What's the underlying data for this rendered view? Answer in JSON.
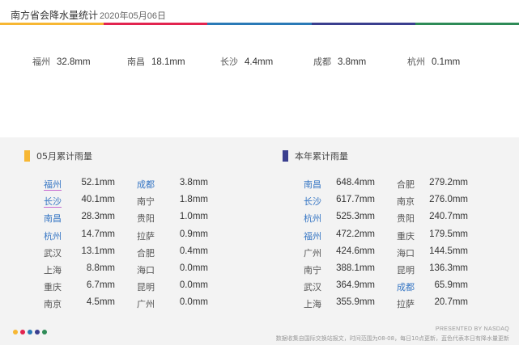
{
  "header": {
    "title": "南方省会降水量统计",
    "date": "2020年05月06日"
  },
  "colors": {
    "bar": [
      "#f7b733",
      "#e2244f",
      "#2a7ab7",
      "#3a3f8f",
      "#2e8b57"
    ],
    "highlight_city": "#3676c4",
    "underline": "#c76ad1",
    "section_may": "#f7b733",
    "section_year": "#3a3f8f",
    "dots": [
      "#f7b733",
      "#e2244f",
      "#2a7ab7",
      "#3a3f8f",
      "#2e8b57"
    ]
  },
  "today": [
    {
      "city": "福州",
      "value": "32.8mm"
    },
    {
      "city": "南昌",
      "value": "18.1mm"
    },
    {
      "city": "长沙",
      "value": "4.4mm"
    },
    {
      "city": "成都",
      "value": "3.8mm"
    },
    {
      "city": "杭州",
      "value": "0.1mm"
    }
  ],
  "may": {
    "title": "05月累计雨量",
    "col1": [
      {
        "city": "福州",
        "value": "52.1mm"
      },
      {
        "city": "长沙",
        "value": "40.1mm"
      },
      {
        "city": "南昌",
        "value": "28.3mm"
      },
      {
        "city": "杭州",
        "value": "14.7mm"
      },
      {
        "city": "武汉",
        "value": "13.1mm"
      },
      {
        "city": "上海",
        "value": "8.8mm"
      },
      {
        "city": "重庆",
        "value": "6.7mm"
      },
      {
        "city": "南京",
        "value": "4.5mm"
      }
    ],
    "col2": [
      {
        "city": "成都",
        "value": "3.8mm"
      },
      {
        "city": "南宁",
        "value": "1.8mm"
      },
      {
        "city": "贵阳",
        "value": "1.0mm"
      },
      {
        "city": "拉萨",
        "value": "0.9mm"
      },
      {
        "city": "合肥",
        "value": "0.4mm"
      },
      {
        "city": "海口",
        "value": "0.0mm"
      },
      {
        "city": "昆明",
        "value": "0.0mm"
      },
      {
        "city": "广州",
        "value": "0.0mm"
      }
    ]
  },
  "year": {
    "title": "本年累计雨量",
    "col1": [
      {
        "city": "南昌",
        "value": "648.4mm"
      },
      {
        "city": "长沙",
        "value": "617.7mm"
      },
      {
        "city": "杭州",
        "value": "525.3mm"
      },
      {
        "city": "福州",
        "value": "472.2mm"
      },
      {
        "city": "广州",
        "value": "424.6mm"
      },
      {
        "city": "南宁",
        "value": "388.1mm"
      },
      {
        "city": "武汉",
        "value": "364.9mm"
      },
      {
        "city": "上海",
        "value": "355.9mm"
      }
    ],
    "col2": [
      {
        "city": "合肥",
        "value": "279.2mm"
      },
      {
        "city": "南京",
        "value": "276.0mm"
      },
      {
        "city": "贵阳",
        "value": "240.7mm"
      },
      {
        "city": "重庆",
        "value": "179.5mm"
      },
      {
        "city": "海口",
        "value": "144.5mm"
      },
      {
        "city": "昆明",
        "value": "136.3mm"
      },
      {
        "city": "成都",
        "value": "65.9mm"
      },
      {
        "city": "拉萨",
        "value": "20.7mm"
      }
    ]
  },
  "footer": {
    "brand": "PRESENTED BY NASDAQ",
    "note": "数据收集自国际交换站报文，时间范围为08-08，每日10点更新，蓝色代表本日有降水量更新"
  }
}
